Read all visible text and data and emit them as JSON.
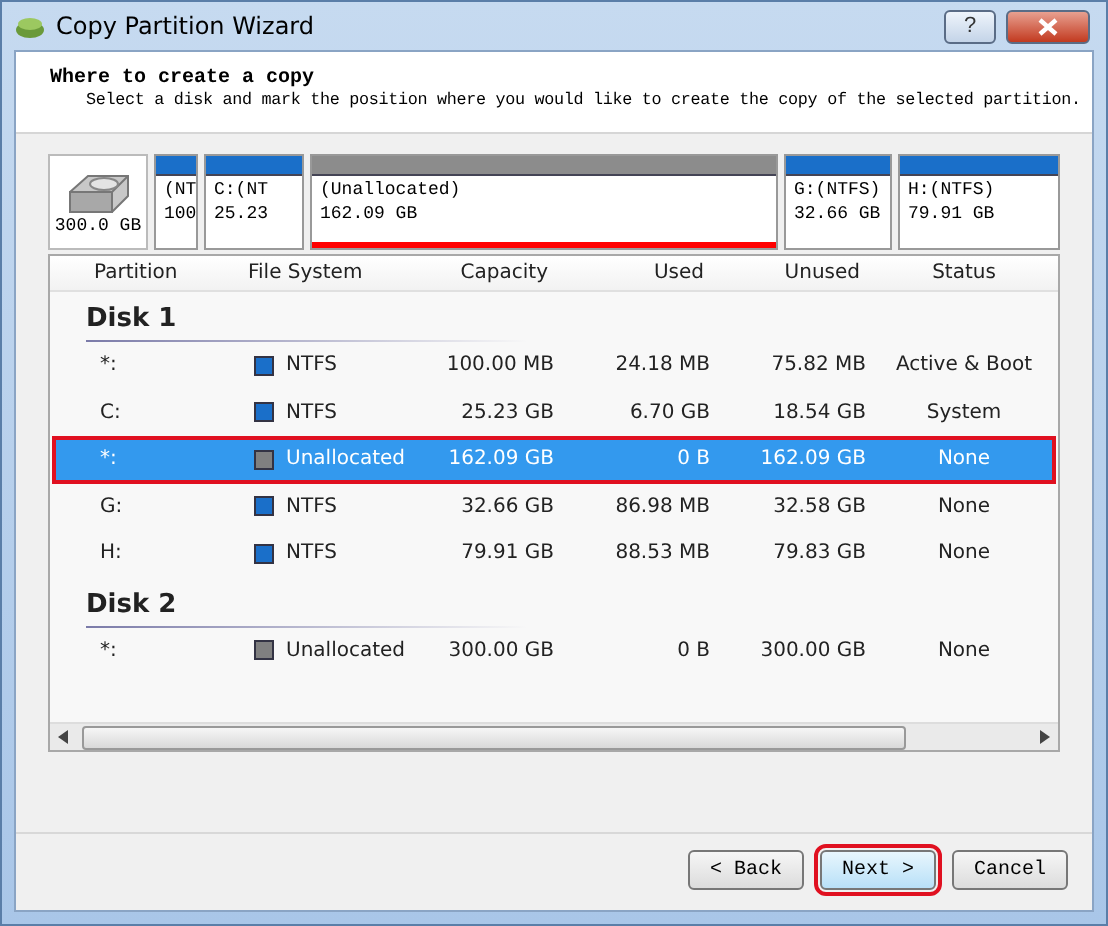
{
  "window": {
    "title": "Copy Partition Wizard",
    "help": "?"
  },
  "header": {
    "title": "Where to create a copy",
    "subtitle": "Select a disk and mark the position where you would like to create the copy of the selected partition."
  },
  "disk_map": {
    "disk_size": "300.0 GB",
    "partitions": [
      {
        "name": "(NT",
        "size": "100",
        "color": "#1a6fc9",
        "selected": false
      },
      {
        "name": "C:(NT",
        "size": "25.23",
        "color": "#1a6fc9",
        "selected": false
      },
      {
        "name": "(Unallocated)",
        "size": "162.09 GB",
        "color": "#8c8c8c",
        "selected": true
      },
      {
        "name": "G:(NTFS)",
        "size": "32.66 GB",
        "color": "#1a6fc9",
        "selected": false
      },
      {
        "name": "H:(NTFS)",
        "size": "79.91 GB",
        "color": "#1a6fc9",
        "selected": false
      }
    ]
  },
  "table": {
    "columns": [
      "Partition",
      "File System",
      "Capacity",
      "Used",
      "Unused",
      "Status"
    ],
    "disks": [
      {
        "label": "Disk 1",
        "rows": [
          {
            "partition": "*:",
            "file_system": "NTFS",
            "color": "#1a6fc9",
            "capacity": "100.00 MB",
            "used": "24.18 MB",
            "unused": "75.82 MB",
            "status": "Active & Boot",
            "selected": false
          },
          {
            "partition": "C:",
            "file_system": "NTFS",
            "color": "#1a6fc9",
            "capacity": "25.23 GB",
            "used": "6.70 GB",
            "unused": "18.54 GB",
            "status": "System",
            "selected": false
          },
          {
            "partition": "*:",
            "file_system": "Unallocated",
            "color": "#808080",
            "capacity": "162.09 GB",
            "used": "0 B",
            "unused": "162.09 GB",
            "status": "None",
            "selected": true
          },
          {
            "partition": "G:",
            "file_system": "NTFS",
            "color": "#1a6fc9",
            "capacity": "32.66 GB",
            "used": "86.98 MB",
            "unused": "32.58 GB",
            "status": "None",
            "selected": false
          },
          {
            "partition": "H:",
            "file_system": "NTFS",
            "color": "#1a6fc9",
            "capacity": "79.91 GB",
            "used": "88.53 MB",
            "unused": "79.83 GB",
            "status": "None",
            "selected": false
          }
        ]
      },
      {
        "label": "Disk 2",
        "rows": [
          {
            "partition": "*:",
            "file_system": "Unallocated",
            "color": "#808080",
            "capacity": "300.00 GB",
            "used": "0 B",
            "unused": "300.00 GB",
            "status": "None",
            "selected": false
          }
        ]
      }
    ]
  },
  "buttons": [
    {
      "label": "< Back",
      "focused": false
    },
    {
      "label": "Next >",
      "focused": true
    },
    {
      "label": "Cancel",
      "focused": false
    }
  ]
}
